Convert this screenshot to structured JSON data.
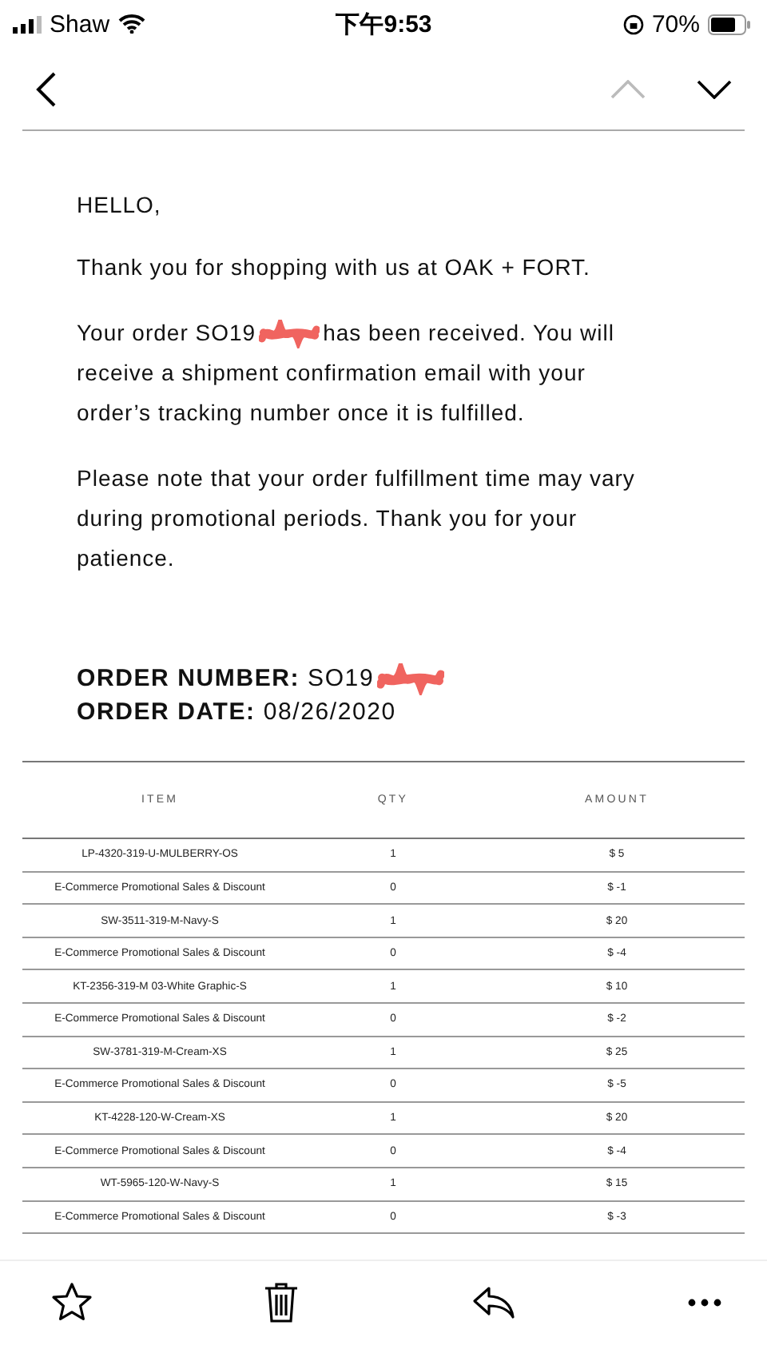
{
  "status_bar": {
    "carrier": "Shaw",
    "time": "下午9:53",
    "battery": "70%"
  },
  "email": {
    "greeting": "HELLO,",
    "thanks": "Thank you for shopping with us at OAK + FORT.",
    "order_intro": "Your order SO19",
    "order_rest_first_line": "has been received. You will",
    "order_rest": "receive a shipment confirmation email with your order’s tracking number once it is fulfilled.",
    "note": "Please note that your order fulfillment time may vary during promotional periods. Thank you for your patience.",
    "order_number_label": "ORDER NUMBER:",
    "order_number": "SO19",
    "order_date_label": "ORDER DATE:",
    "order_date": "08/26/2020"
  },
  "table": {
    "columns": [
      "ITEM",
      "QTY",
      "AMOUNT"
    ],
    "rows": [
      [
        "LP-4320-319-U-MULBERRY-OS",
        "1",
        "$ 5"
      ],
      [
        "E-Commerce Promotional Sales & Discount",
        "0",
        "$ -1"
      ],
      [
        "SW-3511-319-M-Navy-S",
        "1",
        "$ 20"
      ],
      [
        "E-Commerce Promotional Sales & Discount",
        "0",
        "$ -4"
      ],
      [
        "KT-2356-319-M 03-White Graphic-S",
        "1",
        "$ 10"
      ],
      [
        "E-Commerce Promotional Sales & Discount",
        "0",
        "$ -2"
      ],
      [
        "SW-3781-319-M-Cream-XS",
        "1",
        "$ 25"
      ],
      [
        "E-Commerce Promotional Sales & Discount",
        "0",
        "$ -5"
      ],
      [
        "KT-4228-120-W-Cream-XS",
        "1",
        "$ 20"
      ],
      [
        "E-Commerce Promotional Sales & Discount",
        "0",
        "$ -4"
      ],
      [
        "WT-5965-120-W-Navy-S",
        "1",
        "$ 15"
      ],
      [
        "E-Commerce Promotional Sales & Discount",
        "0",
        "$ -3"
      ]
    ]
  },
  "nav": {
    "previous_disabled": true,
    "next_disabled": false
  }
}
